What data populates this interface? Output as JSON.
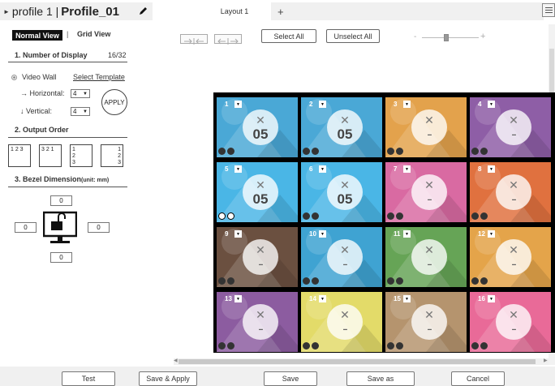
{
  "tabs": {
    "profile_prefix": "profile 1 |",
    "profile_name": "Profile_01",
    "layout_tab": "Layout 1",
    "add_tab": "+"
  },
  "views": {
    "normal": "Normal View",
    "separator": "|",
    "grid": "Grid View"
  },
  "left_panel": {
    "section1_title": "1.  Number of Display",
    "display_count": "16/32",
    "video_wall_label": "Video Wall",
    "select_template": "Select Template",
    "horizontal_label": "Horizontal:",
    "horizontal_value": "4",
    "vertical_label": "Vertical:",
    "vertical_value": "4",
    "apply": "APPLY",
    "section2_title": "2.   Output Order",
    "order_options": {
      "a": "1 2 3",
      "b": "3 2 1",
      "c1": "1",
      "c2": "2",
      "c3": "3",
      "d1": "1",
      "d2": "2",
      "d3": "3"
    },
    "section3_title": "3.  Bezel Dimension",
    "section3_unit": "(unit: mm)",
    "bezel_top": "0",
    "bezel_left": "0",
    "bezel_right": "0",
    "bezel_bottom": "0"
  },
  "toolbar": {
    "select_all": "Select All",
    "unselect_all": "Unselect All",
    "zoom_minus": "-",
    "zoom_plus": "+"
  },
  "grid": {
    "cells": [
      {
        "num": "1",
        "value": "05",
        "color": "#4aa8d6"
      },
      {
        "num": "2",
        "value": "05",
        "color": "#4aa8d6"
      },
      {
        "num": "3",
        "value": "--",
        "color": "#e3a24c"
      },
      {
        "num": "4",
        "value": "--",
        "color": "#8e5ea6"
      },
      {
        "num": "5",
        "value": "05",
        "color": "#4ab6e6",
        "active": true
      },
      {
        "num": "6",
        "value": "05",
        "color": "#4ab6e6"
      },
      {
        "num": "7",
        "value": "--",
        "color": "#d96aa2"
      },
      {
        "num": "8",
        "value": "--",
        "color": "#e0713f"
      },
      {
        "num": "9",
        "value": "--",
        "color": "#6b5040"
      },
      {
        "num": "10",
        "value": "--",
        "color": "#3fa3d2"
      },
      {
        "num": "11",
        "value": "--",
        "color": "#66a456"
      },
      {
        "num": "12",
        "value": "--",
        "color": "#e4a44a"
      },
      {
        "num": "13",
        "value": "--",
        "color": "#8c5ca0"
      },
      {
        "num": "14",
        "value": "--",
        "color": "#e3db69"
      },
      {
        "num": "15",
        "value": "--",
        "color": "#b5946e"
      },
      {
        "num": "16",
        "value": "--",
        "color": "#e96a98"
      }
    ]
  },
  "footer": {
    "test": "Test",
    "save_apply": "Save & Apply",
    "save": "Save",
    "save_as": "Save as",
    "cancel": "Cancel"
  }
}
